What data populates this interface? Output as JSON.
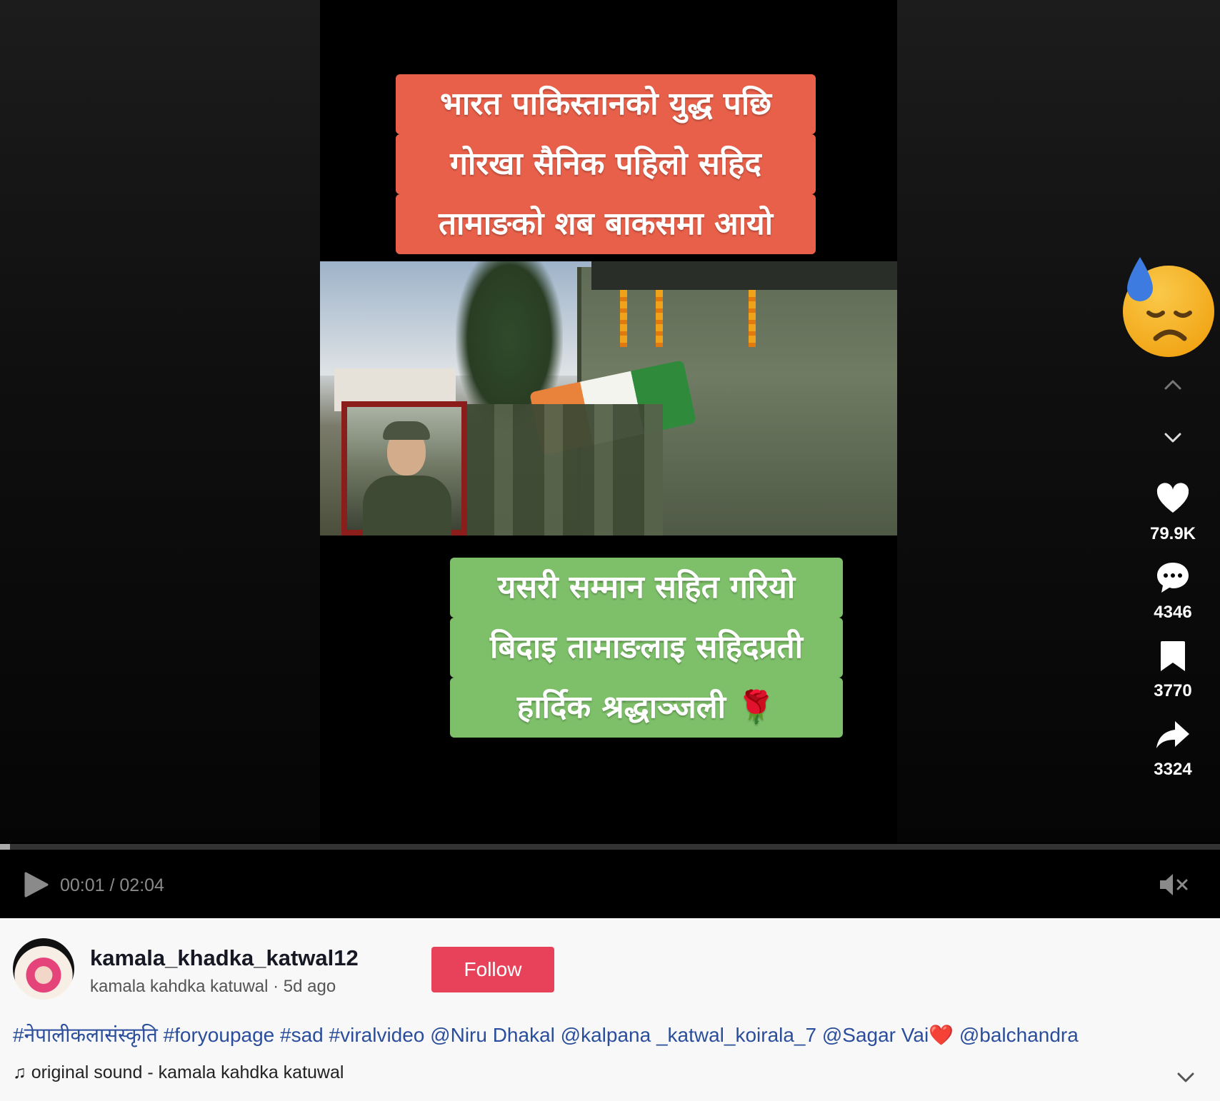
{
  "video": {
    "caption_top": [
      "भारत पाकिस्तानको युद्ध पछि",
      "गोरखा सैनिक पहिलो सहिद",
      "तामाङको शब बाकसमा आयो"
    ],
    "caption_bottom": [
      "यसरी सम्मान सहित गरियो",
      "बिदाइ तामाङलाइ सहिदप्रती",
      "हार्दिक श्रद्धाञ्जली 🌹"
    ],
    "emoji_icon": "sad-sweat-face-icon"
  },
  "controls": {
    "time": "00:01 / 02:04",
    "progress": 0.008,
    "muted": true
  },
  "actions": {
    "likes": "79.9K",
    "comments": "4346",
    "saves": "3770",
    "shares": "3324"
  },
  "author": {
    "username": "kamala_khadka_katwal12",
    "display_name": "kamala kahdka katuwal",
    "posted": "5d ago",
    "separator": " · ",
    "follow_label": "Follow"
  },
  "description": {
    "parts": [
      "#नेपालीकलासंस्कृति",
      "#foryoupage",
      "#sad",
      "#viralvideo",
      "@Niru Dhakal",
      "@kalpana _katwal_koirala_7",
      "@Sagar Vai❤️",
      "@balchandra"
    ]
  },
  "sound": {
    "label": "original sound - kamala kahdka katuwal",
    "icon": "music-note-icon"
  },
  "colors": {
    "follow": "#e8425a",
    "link": "#2b4e9c",
    "caption_top_bg": "#e8604a",
    "caption_bottom_bg": "#7ec06a"
  }
}
